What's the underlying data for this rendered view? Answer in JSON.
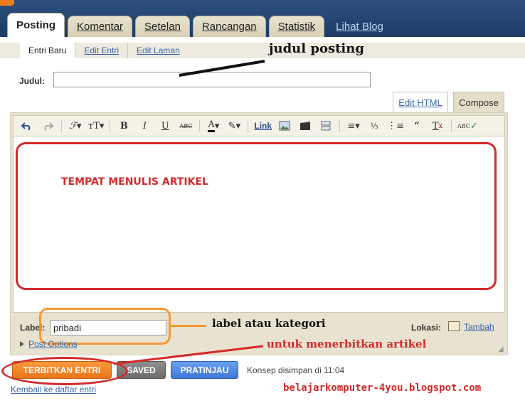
{
  "header": {
    "tabs": [
      {
        "label": "Posting",
        "active": true
      },
      {
        "label": "Komentar"
      },
      {
        "label": "Setelan"
      },
      {
        "label": "Rancangan"
      },
      {
        "label": "Statistik"
      }
    ],
    "view_blog_link": "Lihat Blog"
  },
  "subtabs": [
    {
      "label": "Entri Baru",
      "active": true
    },
    {
      "label": "Edit Entri"
    },
    {
      "label": "Edit Laman"
    }
  ],
  "title_field": {
    "label": "Judul:",
    "value": ""
  },
  "editor_modes": {
    "html": "Edit HTML",
    "compose": "Compose"
  },
  "toolbar": {
    "link_label": "Link"
  },
  "editor_area": {
    "annotation": "TEMPAT MENULIS ARTIKEL"
  },
  "labels_field": {
    "label": "Label:",
    "value": "pribadi"
  },
  "location": {
    "label": "Lokasi:",
    "add_link": "Tambah"
  },
  "post_options": "Post Options",
  "buttons": {
    "publish": "TERBITKAN ENTRI",
    "saved": "SAVED",
    "preview": "PRATINJAU"
  },
  "save_status": "Konsep disimpan di 11:04",
  "back_link": "Kembali ke daftar entri",
  "annotations": {
    "title_note": "judul posting",
    "label_note": "label atau kategori",
    "publish_note": "untuk menerbitkan artikel",
    "watermark": "belajarkomputer-4you.blogspot.com"
  },
  "colors": {
    "header_bg": "#1d3d66",
    "annotation_red": "#d42a2a",
    "annotation_orange": "#f39a33",
    "publish_button": "#e9761a",
    "preview_button": "#3f77d6",
    "link": "#3a64a8"
  }
}
